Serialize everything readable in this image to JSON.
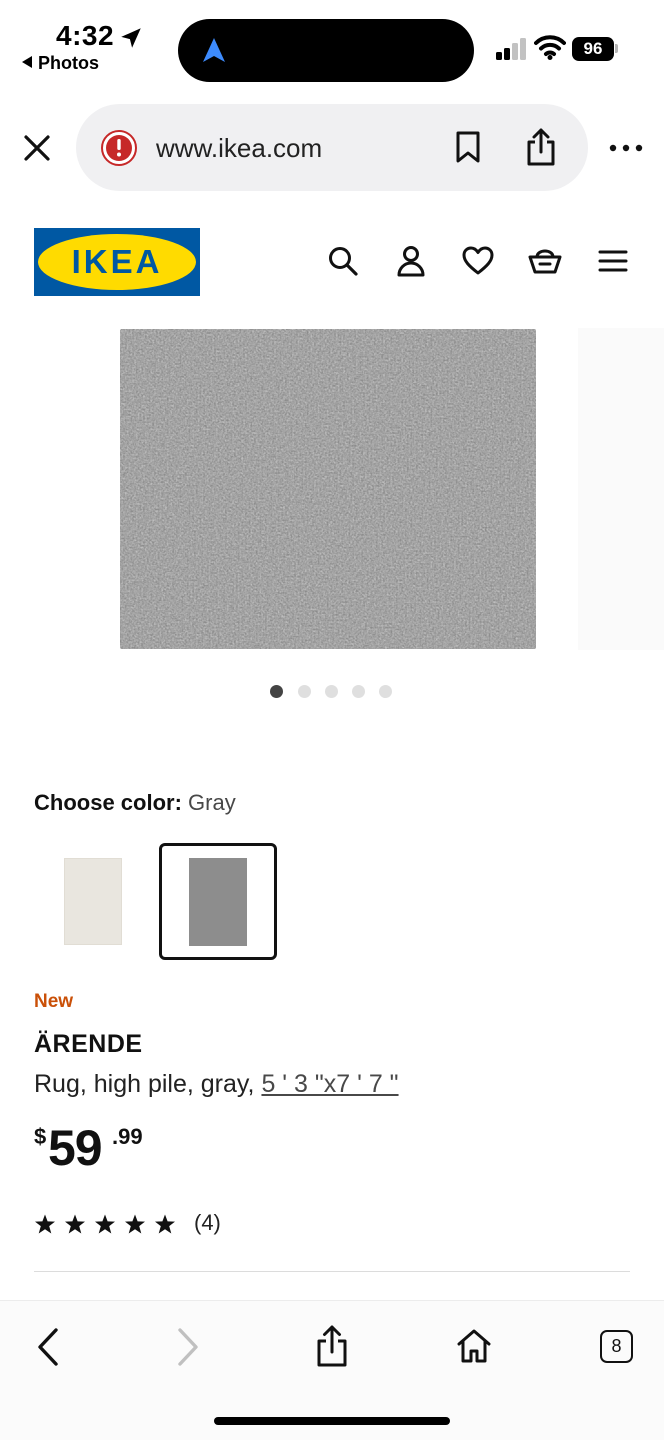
{
  "status_bar": {
    "time": "4:32",
    "back_app": "Photos",
    "battery": "96"
  },
  "browser": {
    "url": "www.ikea.com",
    "tabs_count": "8"
  },
  "logo": {
    "text": "IKEA",
    "colors": {
      "background": "#0058a3",
      "oval": "#ffdb00",
      "text": "#0058a3"
    }
  },
  "header_icons": [
    "search-icon",
    "account-icon",
    "heart-icon",
    "cart-icon",
    "menu-icon"
  ],
  "carousel": {
    "total_images": 5,
    "active_index": 0
  },
  "color_chooser": {
    "label": "Choose color:",
    "selected": "Gray",
    "options": [
      {
        "name": "off-white",
        "swatch": "#e9e6df",
        "selected": false
      },
      {
        "name": "gray",
        "swatch": "#8d8d8d",
        "selected": true
      }
    ]
  },
  "product": {
    "badge": "New",
    "name": "ÄRENDE",
    "description": "Rug, high pile, gray, ",
    "size": "5 ' 3 \"x7 ' 7 \"",
    "price": {
      "currency": "$",
      "integer": "59",
      "decimal": ".99"
    },
    "rating": {
      "stars": 5,
      "max": 5,
      "count": "(4)"
    }
  },
  "theme": {
    "accent_new": "#ca5008",
    "text": "#111111",
    "ikea_blue": "#0058a3",
    "ikea_yellow": "#ffdb00"
  }
}
